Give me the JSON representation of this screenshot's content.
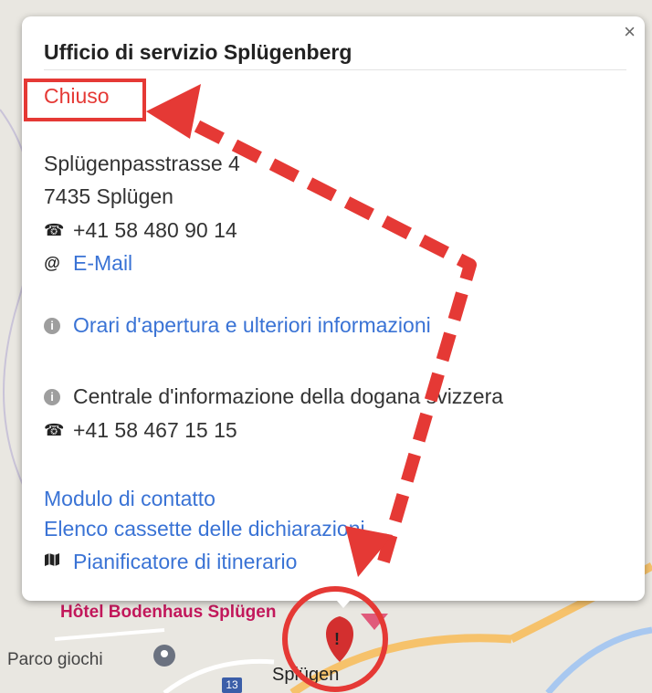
{
  "popup": {
    "title": "Ufficio di servizio Splügenberg",
    "close_label": "×",
    "status": "Chiuso",
    "address_line1": "Splügenpasstrasse 4",
    "address_line2": "7435 Splügen",
    "phone": "+41 58 480 90 14",
    "email_label": "E-Mail",
    "opening_hours_link": "Orari d'apertura e ulteriori informazioni",
    "customs_info": "Centrale d'informazione della dogana svizzera",
    "customs_phone": "+41 58 467 15 15",
    "contact_form_link": "Modulo di contatto",
    "declaration_boxes_link": "Elenco cassette delle dichiarazioni",
    "route_planner_link": "Pianificatore di itinerario"
  },
  "map": {
    "hotel_label": "Hôtel Bodenhaus Splügen",
    "park_label": "Parco giochi",
    "town_label": "Splügen",
    "road_number": "13"
  },
  "icons": {
    "phone": "☎",
    "email": "@",
    "info": "i",
    "map": "map-icon"
  },
  "colors": {
    "status_red": "#e53935",
    "link_blue": "#3a73d5",
    "annotation_red": "#e53935"
  }
}
